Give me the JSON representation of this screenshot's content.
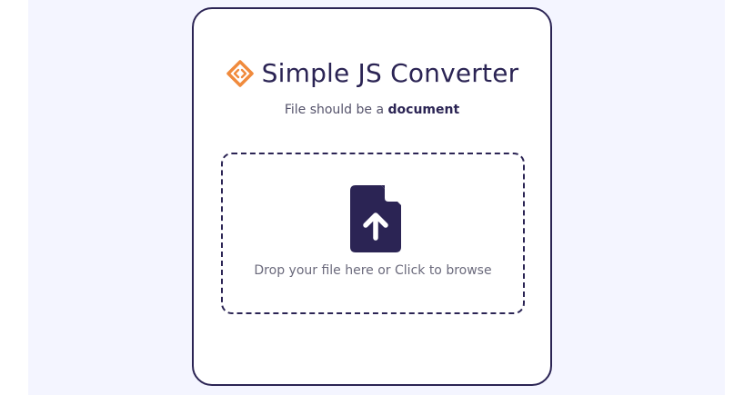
{
  "app": {
    "title": "Simple JS Converter",
    "logo_icon": "code-diamond-icon",
    "subtitle_prefix": "File should be a",
    "subtitle_emphasis": "document"
  },
  "dropzone": {
    "icon": "file-upload-icon",
    "text": "Drop your file here or Click to browse"
  },
  "colors": {
    "primary": "#2b2454",
    "accent": "#f08a3c",
    "background": "#f4f5ff",
    "card": "#ffffff"
  }
}
